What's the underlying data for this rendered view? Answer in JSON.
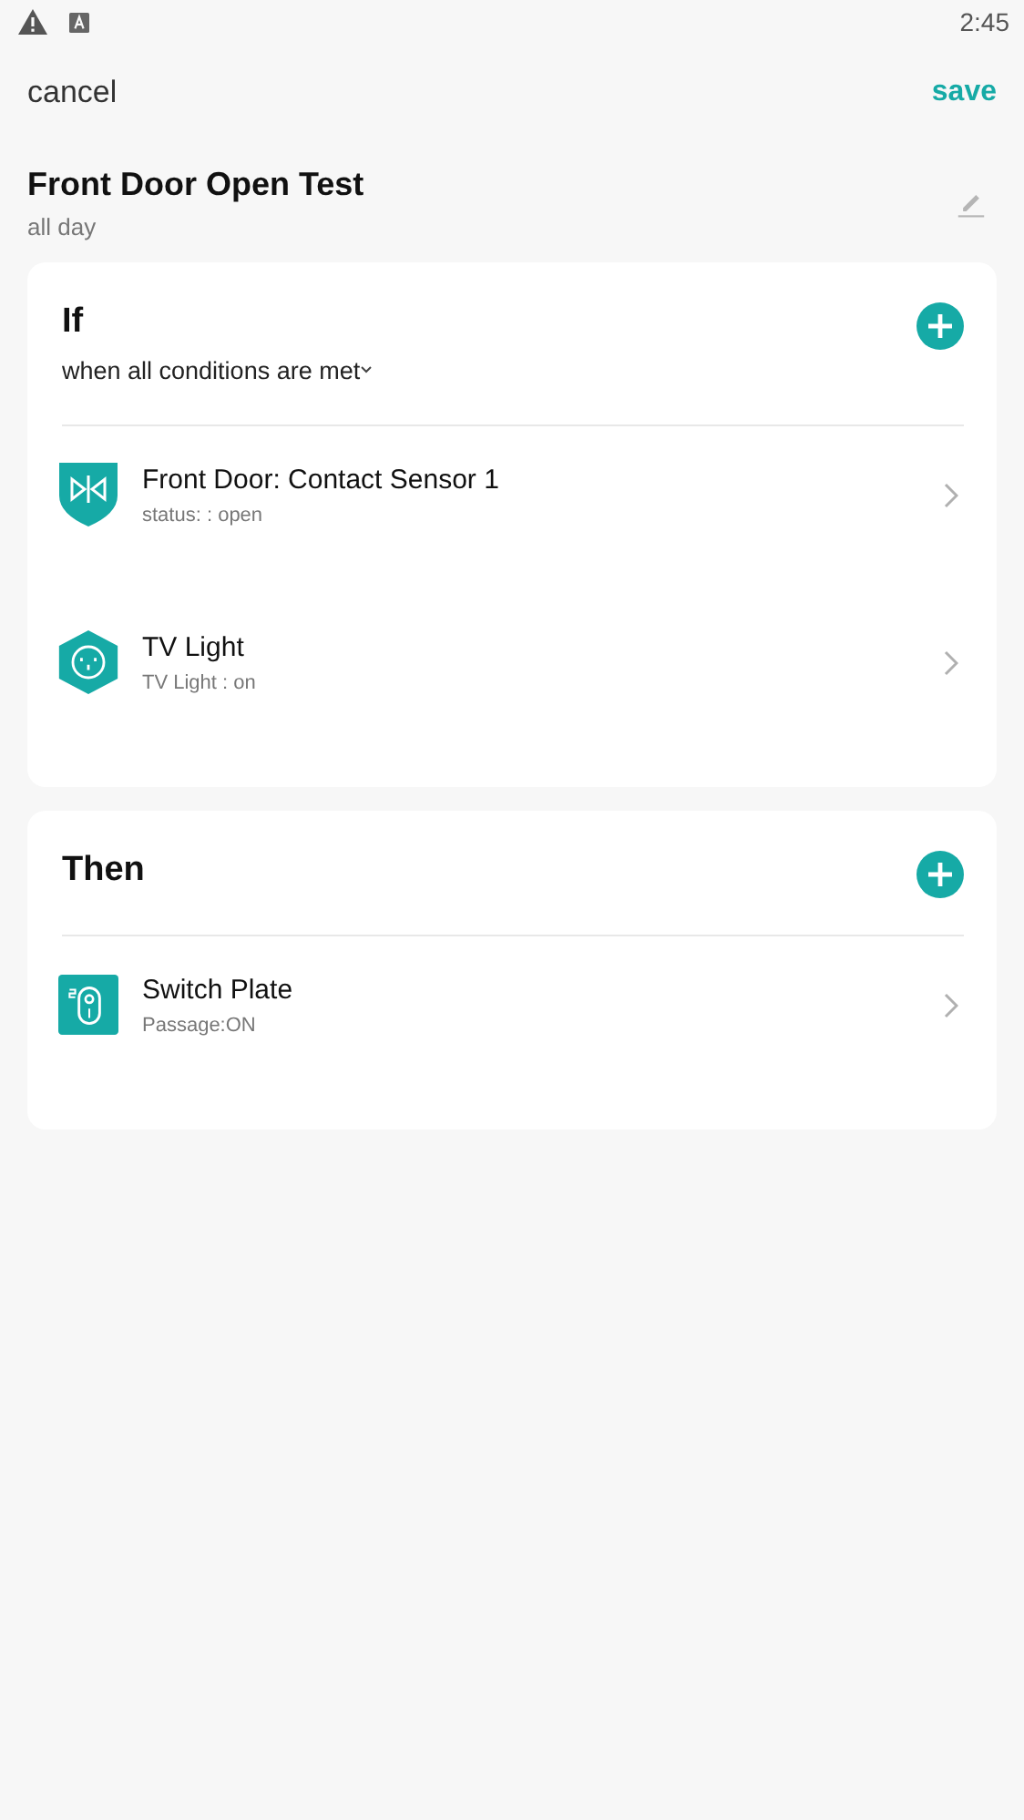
{
  "status_bar": {
    "time": "2:45"
  },
  "header": {
    "cancel": "cancel",
    "save": "save"
  },
  "rule": {
    "title": "Front Door Open Test",
    "schedule": "all day"
  },
  "sections": [
    {
      "title": "If",
      "condition_mode": "when all conditions are met",
      "items": [
        {
          "kind": "sensor",
          "name": "Front Door: Contact Sensor 1",
          "detail": "status: : open"
        },
        {
          "kind": "outlet",
          "name": "TV Light",
          "detail": "TV Light : on"
        }
      ]
    },
    {
      "title": "Then",
      "items": [
        {
          "kind": "switch",
          "name": "Switch Plate",
          "detail": "Passage:ON"
        }
      ]
    }
  ]
}
